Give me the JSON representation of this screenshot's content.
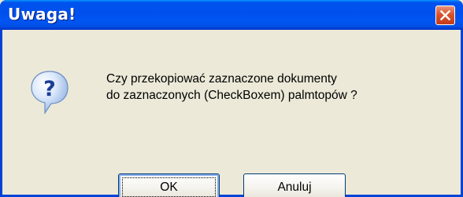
{
  "dialog": {
    "title": "Uwaga!",
    "close_label": "",
    "icon": "question-icon",
    "message_lines": [
      "Czy przekopiować zaznaczone dokumenty",
      "do zaznaczonych (CheckBoxem) palmtopów ?"
    ],
    "buttons": {
      "ok_label": "OK",
      "cancel_label": "Anuluj"
    }
  },
  "colors": {
    "titlebar": "#0053ee",
    "frame": "#0044d8",
    "body": "#ece9d8",
    "close_button": "#d9532c"
  }
}
